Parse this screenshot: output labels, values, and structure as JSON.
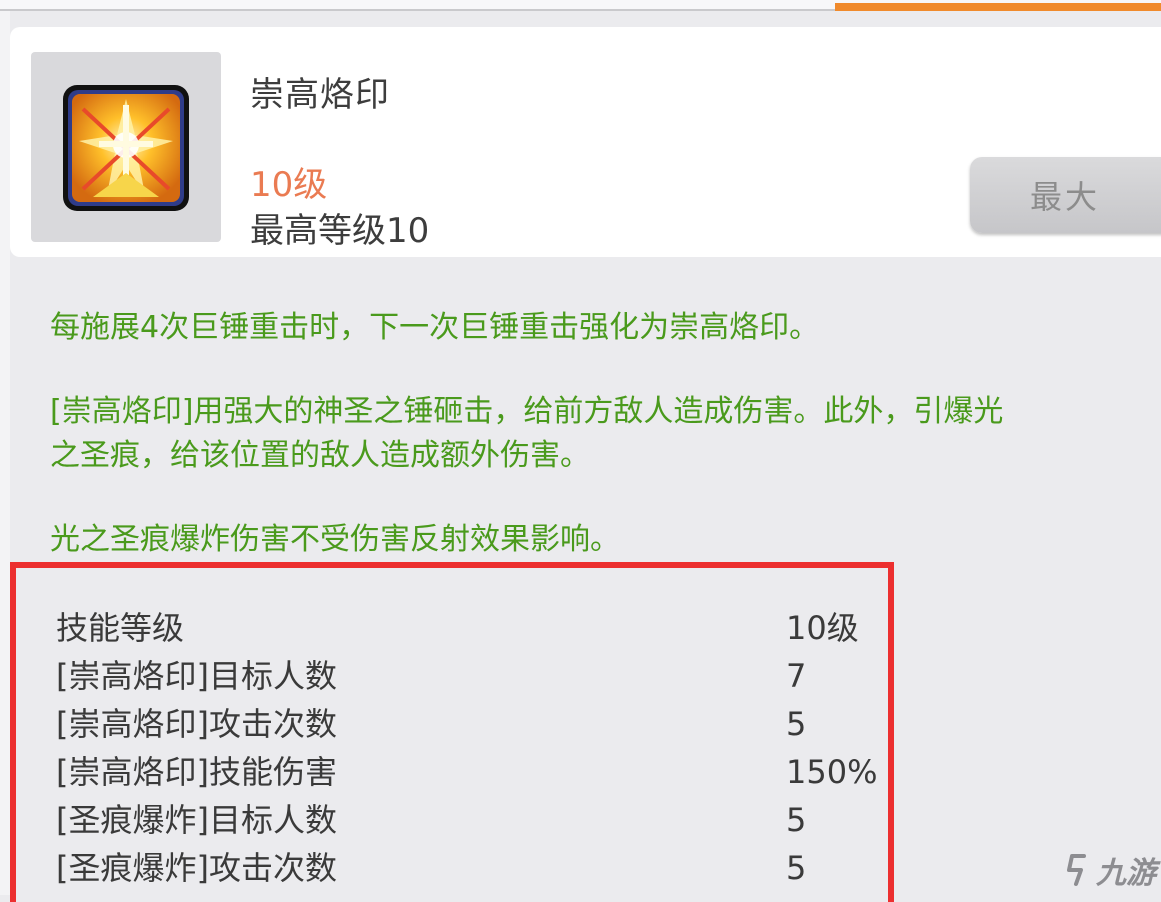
{
  "skill": {
    "name": "崇高烙印",
    "level": "10级",
    "max_level": "最高等级10",
    "max_button_label": "最大"
  },
  "description": {
    "line1": "每施展4次巨锤重击时，下一次巨锤重击强化为崇高烙印。",
    "line2": "[崇高烙印]用强大的神圣之锤砸击，给前方敌人造成伤害。此外，引爆光",
    "line3": "之圣痕，给该位置的敌人造成额外伤害。",
    "line4": "光之圣痕爆炸伤害不受伤害反射效果影响。"
  },
  "stats": [
    {
      "label": "技能等级",
      "value": "10级"
    },
    {
      "label": "[崇高烙印]目标人数",
      "value": "7"
    },
    {
      "label": "[崇高烙印]攻击次数",
      "value": "5"
    },
    {
      "label": "[崇高烙印]技能伤害",
      "value": "150%"
    },
    {
      "label": "[圣痕爆炸]目标人数",
      "value": "5"
    },
    {
      "label": "[圣痕爆炸]攻击次数",
      "value": "5"
    }
  ],
  "watermark": {
    "text": "九游"
  },
  "colors": {
    "accent": "#f08a2c",
    "description_text": "#4a9a1c",
    "level_text": "#ea7b52",
    "highlight_border": "#ec2f2f"
  }
}
